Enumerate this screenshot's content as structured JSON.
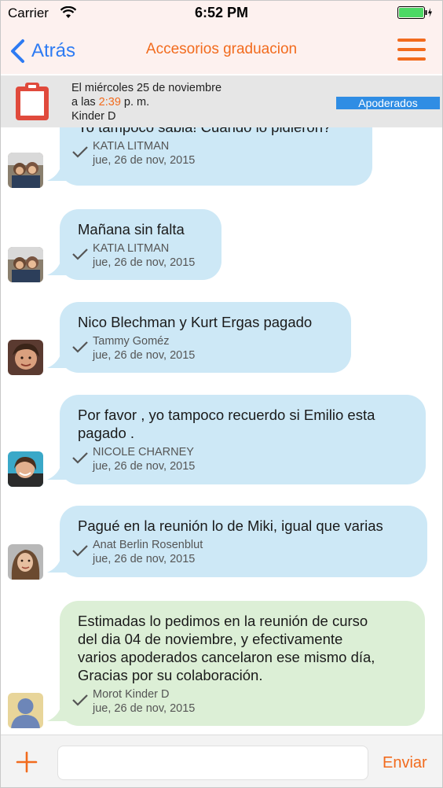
{
  "status_bar": {
    "carrier": "Carrier",
    "time": "6:52 PM"
  },
  "nav": {
    "back_label": "Atrás",
    "title": "Accesorios graduacion"
  },
  "event": {
    "line1": "El miércoles 25 de noviembre",
    "line2_prefix": "a las ",
    "time": "2:39",
    "line2_suffix": " p. m.",
    "line3": "Kinder D",
    "audience": "Apoderados"
  },
  "messages": [
    {
      "text": "Yo tampoco sabia! Cuando lo pidieron?",
      "author": "KATIA LITMAN",
      "date": "jue, 26 de nov, 2015",
      "color": "blue",
      "avatar": "avatar-katia"
    },
    {
      "text": "Mañana sin falta",
      "author": "KATIA LITMAN",
      "date": "jue, 26 de nov, 2015",
      "color": "blue",
      "avatar": "avatar-katia"
    },
    {
      "text": "Nico Blechman y Kurt Ergas pagado",
      "author": "Tammy Goméz",
      "date": "jue, 26 de nov, 2015",
      "color": "blue",
      "avatar": "avatar-tammy"
    },
    {
      "text": "Por favor , yo tampoco recuerdo si Emilio esta\npagado .",
      "author": "NICOLE CHARNEY",
      "date": "jue, 26 de nov, 2015",
      "color": "blue",
      "avatar": "avatar-nicole"
    },
    {
      "text": "Pagué en la reunión lo de Miki, igual que varias",
      "author": "Anat Berlin Rosenblut",
      "date": "jue, 26 de nov, 2015",
      "color": "blue",
      "avatar": "avatar-anat"
    },
    {
      "text": "Estimadas lo pedimos en la reunión de curso\ndel dia 04 de noviembre, y efectivamente\nvarios apoderados cancelaron ese mismo día,\nGracias por su colaboración.",
      "author": "Morot Kinder D",
      "date": "jue, 26 de nov, 2015",
      "color": "green",
      "avatar": "avatar-default"
    }
  ],
  "input_bar": {
    "placeholder": "",
    "send_label": "Enviar"
  },
  "colors": {
    "accent": "#f26b1d",
    "link": "#2d7bf3",
    "bubble_blue": "#cde8f6",
    "bubble_green": "#dcefd6",
    "badge": "#2f8de4"
  }
}
